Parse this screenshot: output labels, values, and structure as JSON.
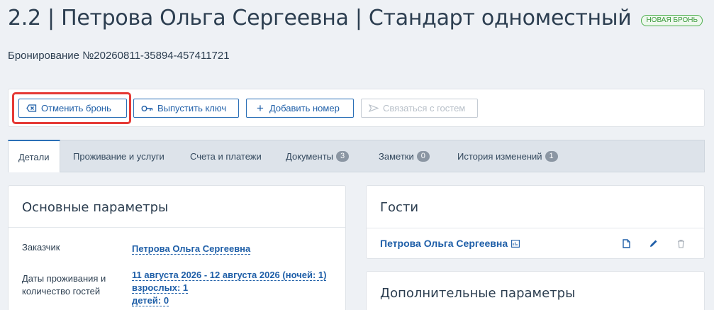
{
  "header": {
    "title": "2.2 | Петрова Ольга Сергеевна | Стандарт одноместный",
    "status_badge": "НОВАЯ БРОНЬ",
    "booking_number": "Бронирование №20260811-35894-457411721"
  },
  "toolbar": {
    "cancel_label": "Отменить бронь",
    "key_label": "Выпустить ключ",
    "add_room_label": "Добавить номер",
    "contact_label": "Связаться с гостем"
  },
  "tabs": [
    {
      "label": "Детали"
    },
    {
      "label": "Проживание и услуги"
    },
    {
      "label": "Счета и платежи"
    },
    {
      "label": "Документы",
      "count": "3"
    },
    {
      "label": "Заметки",
      "count": "0"
    },
    {
      "label": "История изменений",
      "count": "1"
    }
  ],
  "main_params": {
    "title": "Основные параметры",
    "customer_label": "Заказчик",
    "customer_value": "Петрова Ольга Сергеевна",
    "dates_label_line1": "Даты проживания и",
    "dates_label_line2": "количество гостей",
    "dates_value": "11 августа 2026 - 12 августа 2026 (ночей: 1)",
    "adults_value": "взрослых: 1",
    "children_value": "детей: 0"
  },
  "guests": {
    "title": "Гости",
    "guest_name": "Петрова Ольга Сергеевна"
  },
  "extra_params": {
    "title": "Дополнительные параметры"
  },
  "colors": {
    "accent": "#1f5fa8",
    "highlight": "#e53935",
    "badge": "#3c9a3c"
  }
}
